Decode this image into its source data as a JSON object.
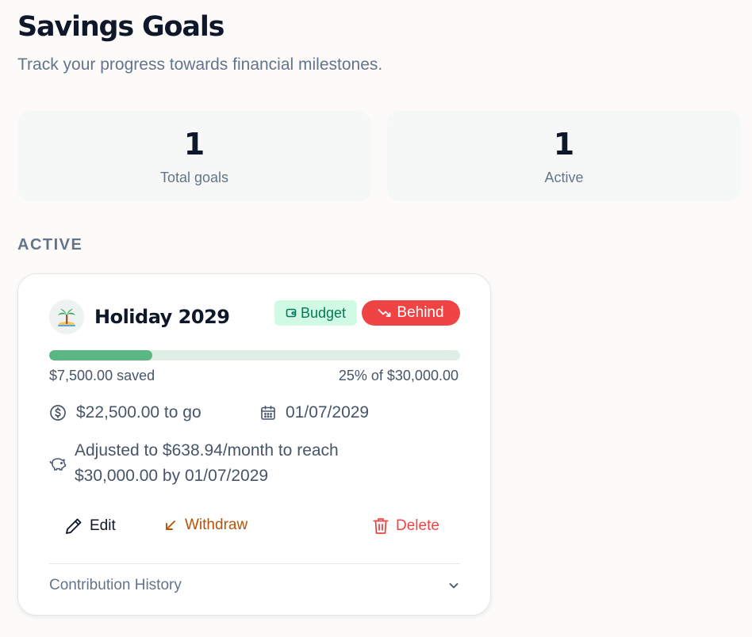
{
  "header": {
    "title": "Savings Goals",
    "subtitle": "Track your progress towards financial milestones."
  },
  "stats": [
    {
      "value": "1",
      "label": "Total goals"
    },
    {
      "value": "1",
      "label": "Active"
    }
  ],
  "section": {
    "label": "ACTIVE"
  },
  "goal": {
    "emoji": "🏝️",
    "name": "Holiday 2029",
    "badge_budget": "Budget",
    "badge_status": "Behind",
    "progress_percent": 25,
    "saved_text": "$7,500.00 saved",
    "percent_text": "25% of $30,000.00",
    "remaining_text": "$22,500.00 to go",
    "target_date": "01/07/2029",
    "adjusted_text": "Adjusted to $638.94/month to reach $30,000.00 by 01/07/2029",
    "actions": {
      "edit": "Edit",
      "withdraw": "Withdraw",
      "delete": "Delete"
    },
    "history_label": "Contribution History"
  },
  "icons": {
    "budget": "wallet-icon",
    "status": "trending-down-icon",
    "remaining": "dollar-circle-icon",
    "date": "calendar-icon",
    "adjusted": "piggy-bank-icon",
    "edit": "pencil-icon",
    "withdraw": "arrow-down-left-icon",
    "delete": "trash-icon",
    "history": "chevron-down-icon"
  },
  "colors": {
    "progress_fill": "#5ab784",
    "progress_track": "#dfeee6",
    "behind_badge": "#ef4444",
    "budget_badge_bg": "#d1fae5",
    "budget_badge_text": "#047857",
    "withdraw": "#b45309",
    "delete": "#ef4444"
  }
}
